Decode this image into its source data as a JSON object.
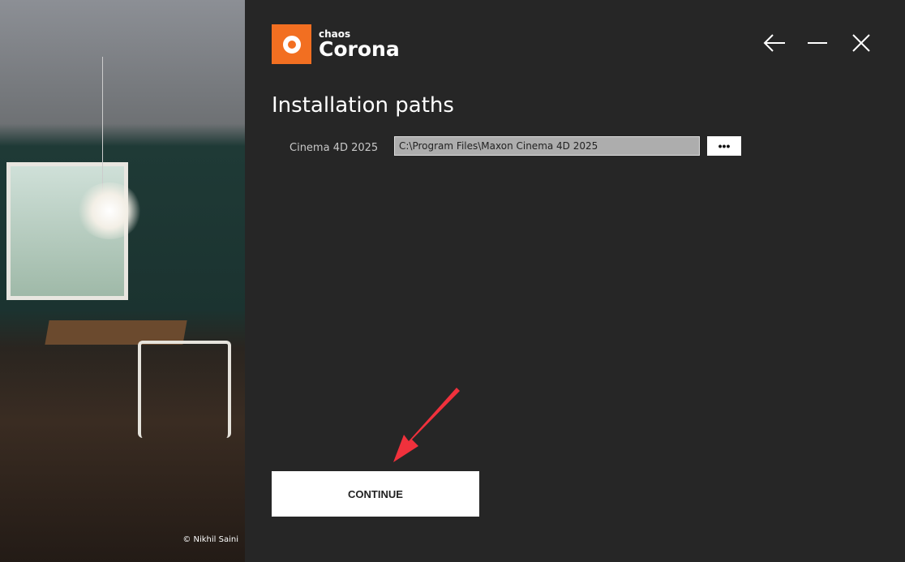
{
  "photo": {
    "credit": "© Nikhil Saini"
  },
  "logo": {
    "brand_small": "chaos",
    "brand_big": "Corona",
    "accent": "#f26f21"
  },
  "window_controls": {
    "back": "←",
    "minimize": "—",
    "close": "✕"
  },
  "page": {
    "title": "Installation paths"
  },
  "paths": [
    {
      "label": "Cinema 4D 2025",
      "value": "C:\\Program Files\\Maxon Cinema 4D 2025",
      "browse_label": "•••"
    }
  ],
  "continue_label": "CONTINUE",
  "annotation": {
    "arrow_color": "#f0313c"
  }
}
